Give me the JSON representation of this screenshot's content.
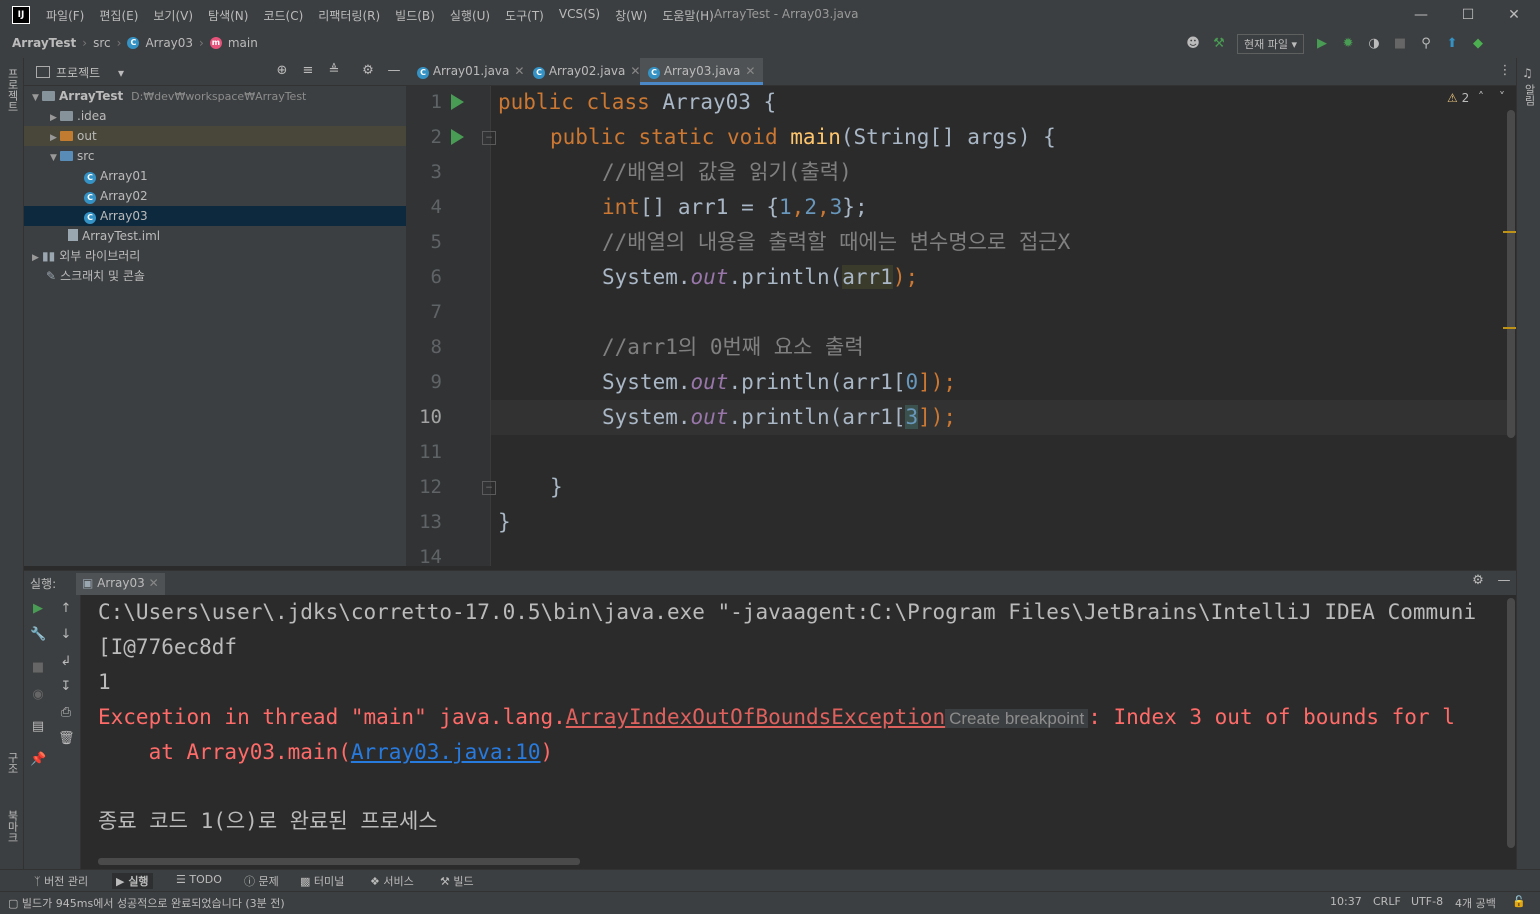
{
  "window": {
    "logo": "IJ",
    "title": "ArrayTest - Array03.java",
    "menu": [
      "파일(F)",
      "편집(E)",
      "보기(V)",
      "탐색(N)",
      "코드(C)",
      "리팩터링(R)",
      "빌드(B)",
      "실행(U)",
      "도구(T)",
      "VCS(S)",
      "창(W)",
      "도움말(H)"
    ]
  },
  "breadcrumb": [
    "ArrayTest",
    "src",
    "Array03",
    "main"
  ],
  "toolbar": {
    "run_config": "현재 파일"
  },
  "left_stripe": {
    "project": "프로젝트",
    "structure": "구조",
    "bookmarks": "북마크"
  },
  "right_stripe": {
    "notifications": "알림"
  },
  "project_panel": {
    "title": "프로젝트",
    "tree": [
      {
        "label": "ArrayTest",
        "path": "D:₩dev₩workspace₩ArrayTest"
      },
      {
        "label": ".idea"
      },
      {
        "label": "out"
      },
      {
        "label": "src"
      },
      {
        "label": "Array01"
      },
      {
        "label": "Array02"
      },
      {
        "label": "Array03"
      },
      {
        "label": "ArrayTest.iml"
      },
      {
        "label": "외부 라이브러리"
      },
      {
        "label": "스크래치 및 콘솔"
      }
    ]
  },
  "editor": {
    "tabs": [
      "Array01.java",
      "Array02.java",
      "Array03.java"
    ],
    "active_tab": "Array03.java",
    "warnings": "2",
    "line_numbers": [
      "1",
      "2",
      "3",
      "4",
      "5",
      "6",
      "7",
      "8",
      "9",
      "10",
      "11",
      "12",
      "13",
      "14"
    ],
    "current_line": 10,
    "code": {
      "l1_public": "public",
      "l1_class": "class",
      "l1_name": "Array03 {",
      "l2_public": "public",
      "l2_static": "static",
      "l2_void": "void",
      "l2_main": "main",
      "l2_rest": "(String[] args) {",
      "l3": "//배열의 값을 읽기(출력)",
      "l4_int": "int",
      "l4_mid": "[] arr1 = {",
      "l4_n1": "1",
      "l4_c1": ",",
      "l4_n2": "2",
      "l4_c2": ",",
      "l4_n3": "3",
      "l4_end": "};",
      "l5": "//배열의 내용을 출력할 때에는 변수명으로 접근X",
      "sys": "System.",
      "out": "out",
      "println": ".println(",
      "l6_arg": "arr1",
      "l6_end": ");",
      "l8": "//arr1의 0번째 요소 출력",
      "l9_arg": "arr1[",
      "l9_idx": "0",
      "l9_end": "]);",
      "l10_idx": "3",
      "l12": "}",
      "l13": "}"
    }
  },
  "run_panel": {
    "label": "실행:",
    "tab": "Array03",
    "lines": {
      "cmd": "C:\\Users\\user\\.jdks\\corretto-17.0.5\\bin\\java.exe \"-javaagent:C:\\Program Files\\JetBrains\\IntelliJ IDEA Communi",
      "out1": "[I@776ec8df",
      "out2": "1",
      "exc_prefix": "Exception in thread \"main\" java.lang.",
      "exc_class": "ArrayIndexOutOfBoundsException",
      "create_bp": "Create breakpoint",
      "exc_suffix": ": Index 3 out of bounds for l",
      "at_prefix": "    at Array03.main(",
      "at_link": "Array03.java:10",
      "at_suffix": ")",
      "exit": "종료 코드 1(으)로 완료된 프로세스"
    }
  },
  "bottom_tabs": [
    "버전 관리",
    "실행",
    "TODO",
    "문제",
    "터미널",
    "서비스",
    "빌드"
  ],
  "status_bar": {
    "message": "빌드가 945ms에서 성공적으로 완료되었습니다 (3분 전)",
    "position": "10:37",
    "line_sep": "CRLF",
    "encoding": "UTF-8",
    "indent": "4개 공백"
  },
  "colors": {
    "keyword": "#cc7832",
    "method": "#ffc66d",
    "comment": "#808080",
    "number": "#6897bb",
    "field": "#9876aa",
    "error": "#ff6b68",
    "link": "#287bde"
  }
}
